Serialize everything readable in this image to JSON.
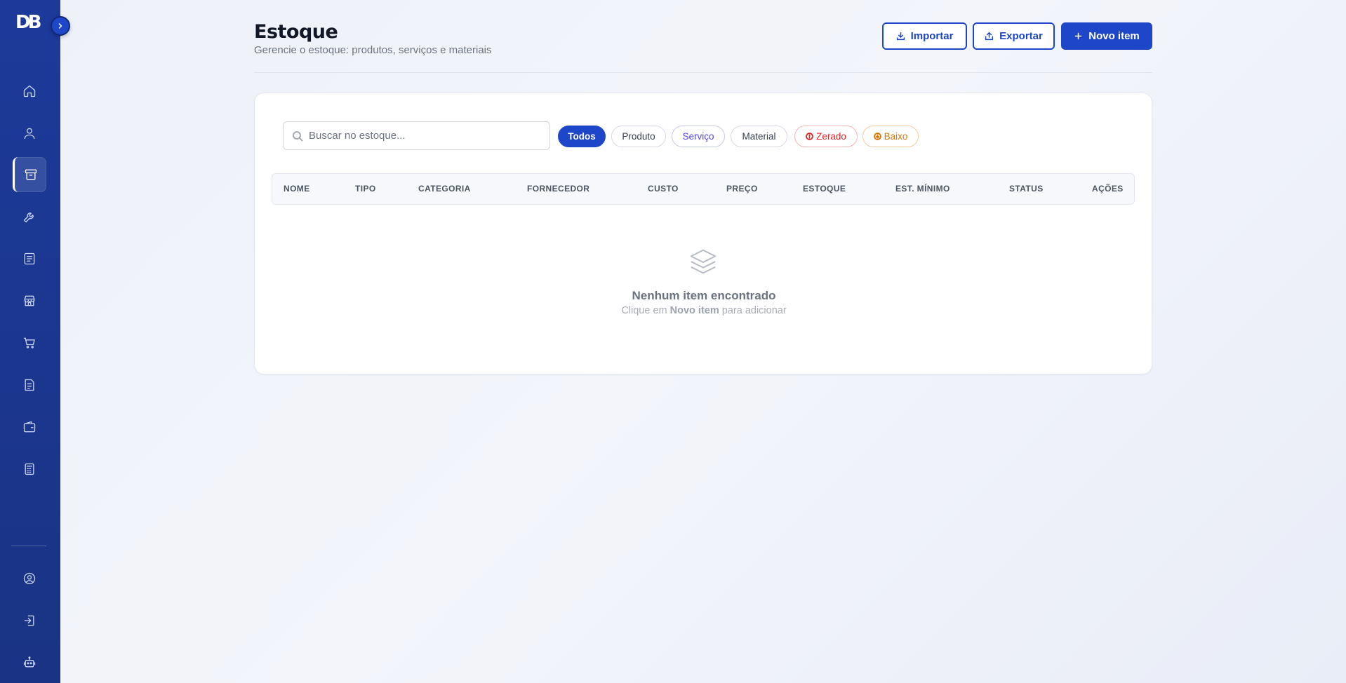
{
  "sidebar": {
    "logo": "DB",
    "items": [
      {
        "icon": "home-icon"
      },
      {
        "icon": "user-icon"
      },
      {
        "icon": "archive-icon",
        "active": true
      },
      {
        "icon": "wrench-icon"
      },
      {
        "icon": "list-icon"
      },
      {
        "icon": "store-icon"
      },
      {
        "icon": "cart-icon"
      },
      {
        "icon": "report-icon"
      },
      {
        "icon": "wallet-icon"
      },
      {
        "icon": "calculator-icon"
      }
    ],
    "bottom_items": [
      {
        "icon": "user-circle-icon"
      },
      {
        "icon": "logout-icon"
      },
      {
        "icon": "robot-icon"
      }
    ]
  },
  "header": {
    "title": "Estoque",
    "subtitle": "Gerencie o estoque: produtos, serviços e materiais",
    "import_label": "Importar",
    "export_label": "Exportar",
    "new_item_label": "Novo item"
  },
  "search": {
    "placeholder": "Buscar no estoque...",
    "value": ""
  },
  "filters": {
    "todos": "Todos",
    "produto": "Produto",
    "servico": "Serviço",
    "material": "Material",
    "zerado": "Zerado",
    "baixo": "Baixo"
  },
  "table": {
    "columns": [
      "NOME",
      "TIPO",
      "CATEGORIA",
      "FORNECEDOR",
      "CUSTO",
      "PREÇO",
      "ESTOQUE",
      "EST. MÍNIMO",
      "STATUS",
      "AÇÕES"
    ],
    "rows": []
  },
  "empty_state": {
    "title": "Nenhum item encontrado",
    "hint_prefix": "Clique em",
    "hint_strong": "Novo item",
    "hint_suffix": "para adicionar"
  },
  "colors": {
    "primary": "#1d46c8",
    "sidebar": "#1c3a9a",
    "zerado": "#dc2626",
    "baixo": "#d97706",
    "servico": "#4f46e5"
  }
}
